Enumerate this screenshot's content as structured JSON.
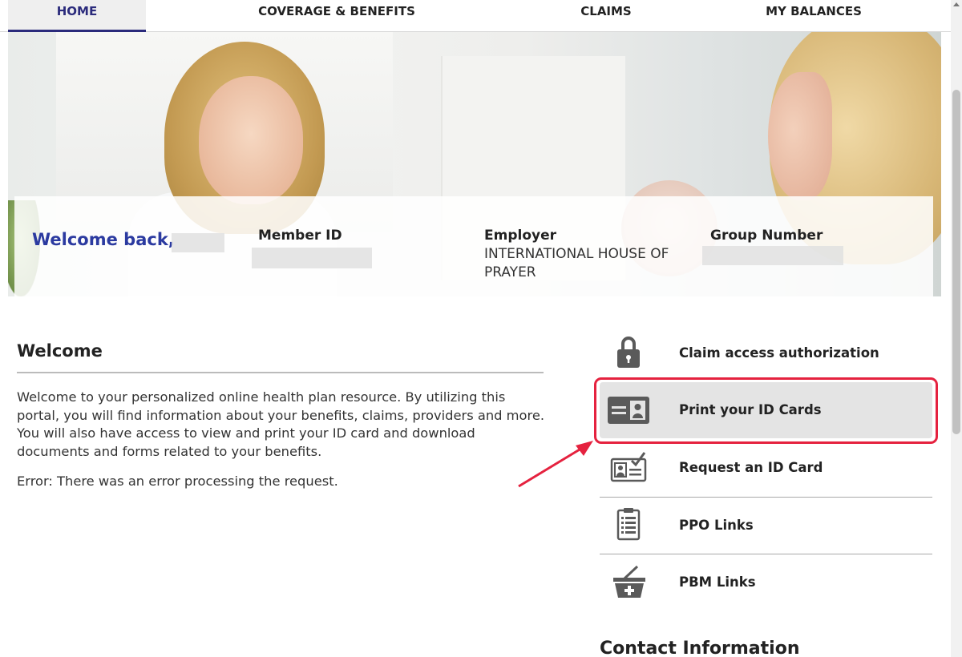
{
  "nav": {
    "items": [
      {
        "label": "HOME",
        "active": true
      },
      {
        "label": "COVERAGE & BENEFITS",
        "active": false
      },
      {
        "label": "CLAIMS",
        "active": false
      },
      {
        "label": "MY BALANCES",
        "active": false
      }
    ]
  },
  "member_info": {
    "welcome": "Welcome back,",
    "member_id_label": "Member ID",
    "employer_label": "Employer",
    "employer_value": "INTERNATIONAL HOUSE OF PRAYER",
    "group_number_label": "Group Number"
  },
  "welcome_section": {
    "heading": "Welcome",
    "body": "Welcome to your personalized online health plan resource. By utilizing this portal, you will find information about your benefits, claims, providers and more. You will also have access to view and print your ID card and download documents and forms related to your benefits.",
    "error": "Error: There was an error processing the request."
  },
  "actions": [
    {
      "label": "Claim access authorization",
      "icon": "lock-icon"
    },
    {
      "label": "Print your ID Cards",
      "icon": "id-card-icon",
      "highlighted": true
    },
    {
      "label": "Request an ID Card",
      "icon": "id-card-check-icon"
    },
    {
      "label": "PPO Links",
      "icon": "clipboard-list-icon"
    },
    {
      "label": "PBM Links",
      "icon": "basket-plus-icon"
    }
  ],
  "contact": {
    "heading": "Contact Information"
  },
  "colors": {
    "accent": "#2b2b7c",
    "welcome_blue": "#2b3aa0",
    "annotation_red": "#e5223f",
    "icon_gray": "#5a5a5a"
  }
}
